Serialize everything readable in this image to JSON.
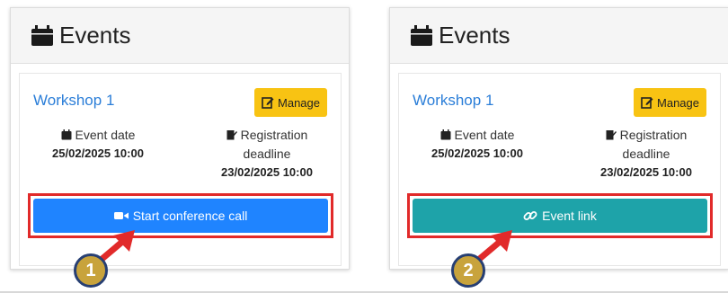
{
  "panels": [
    {
      "header_title": "Events",
      "event_name": "Workshop 1",
      "manage_label": "Manage",
      "event_date_label": "Event date",
      "event_date_value": "25/02/2025 10:00",
      "registration_label_1": "Registration",
      "registration_label_2": "deadline",
      "registration_value": "23/02/2025 10:00",
      "action_label": "Start conference call",
      "action_icon": "video-camera-icon",
      "step_number": "1"
    },
    {
      "header_title": "Events",
      "event_name": "Workshop 1",
      "manage_label": "Manage",
      "event_date_label": "Event date",
      "event_date_value": "25/02/2025 10:00",
      "registration_label_1": "Registration",
      "registration_label_2": "deadline",
      "registration_value": "23/02/2025 10:00",
      "action_label": "Event link",
      "action_icon": "link-icon",
      "step_number": "2"
    }
  ],
  "colors": {
    "link_blue": "#2b7ed8",
    "manage_yellow": "#f8c313",
    "call_button_blue": "#1f84ff",
    "link_button_teal": "#1ea3a9",
    "highlight_red": "#e12a2a",
    "badge_gold": "#c8a33c",
    "badge_border_navy": "#273f73"
  }
}
